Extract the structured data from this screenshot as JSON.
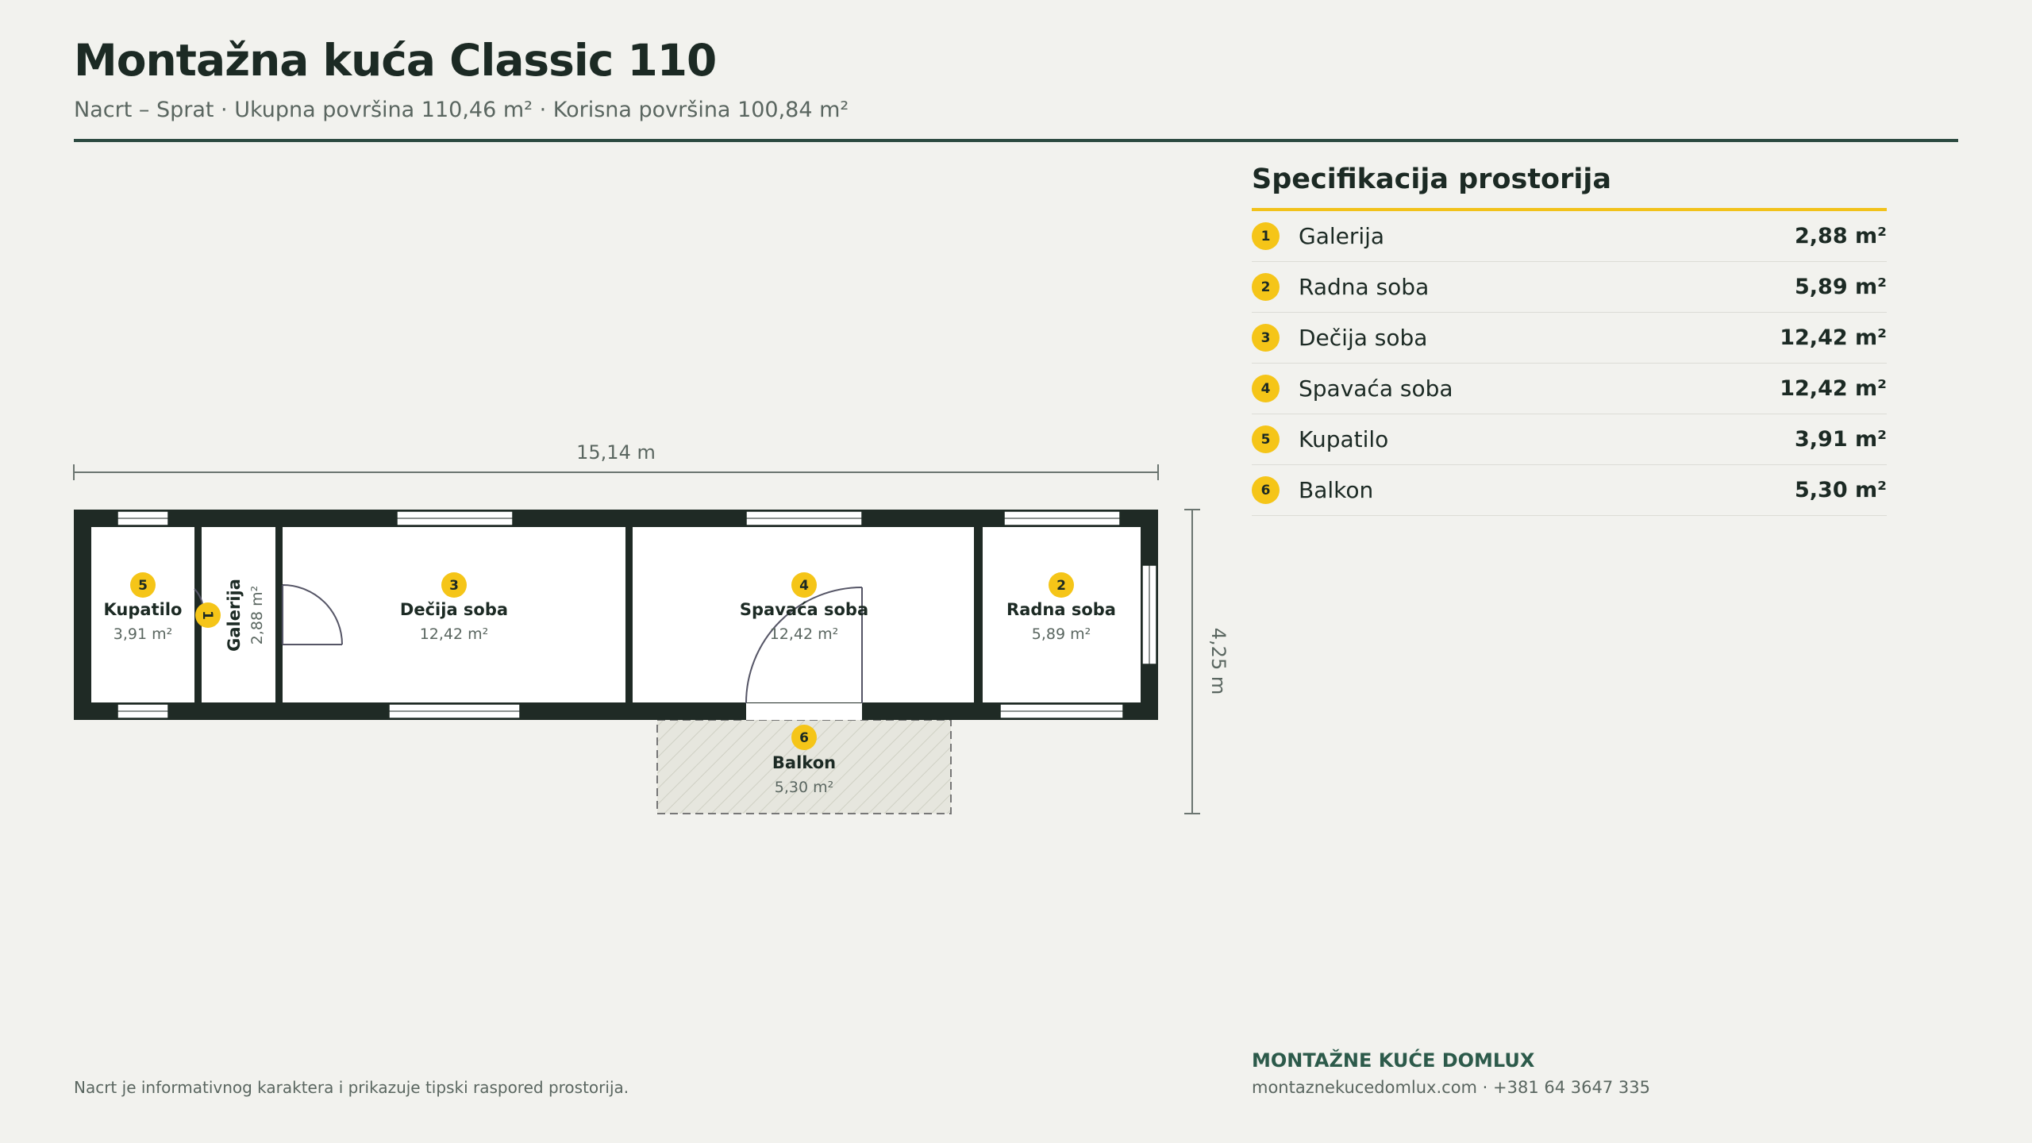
{
  "header": {
    "title": "Montažna kuća Classic 110",
    "subtitle": "Nacrt – Sprat · Ukupna površina 110,46 m² · Korisna površina 100,84 m²"
  },
  "plan": {
    "width_label": "15,14 m",
    "depth_label": "4,25 m",
    "rooms": [
      {
        "num": "5",
        "name": "Kupatilo",
        "area": "3,91 m²"
      },
      {
        "num": "1",
        "name": "Galerija",
        "area": "2,88 m²"
      },
      {
        "num": "3",
        "name": "Dečija soba",
        "area": "12,42 m²"
      },
      {
        "num": "4",
        "name": "Spavaća soba",
        "area": "12,42 m²"
      },
      {
        "num": "2",
        "name": "Radna soba",
        "area": "5,89 m²"
      },
      {
        "num": "6",
        "name": "Balkon",
        "area": "5,30 m²"
      }
    ]
  },
  "spec": {
    "title": "Specifikacija prostorija",
    "rows": [
      {
        "num": "1",
        "name": "Galerija",
        "area": "2,88 m²"
      },
      {
        "num": "2",
        "name": "Radna soba",
        "area": "5,89 m²"
      },
      {
        "num": "3",
        "name": "Dečija soba",
        "area": "12,42 m²"
      },
      {
        "num": "4",
        "name": "Spavaća soba",
        "area": "12,42 m²"
      },
      {
        "num": "5",
        "name": "Kupatilo",
        "area": "3,91 m²"
      },
      {
        "num": "6",
        "name": "Balkon",
        "area": "5,30 m²"
      }
    ]
  },
  "footer": {
    "note": "Nacrt je informativnog karaktera i prikazuje tipski raspored prostorija.",
    "brand": "MONTAŽNE KUĆE DOMLUX",
    "contact": "montaznekucedomlux.com · +381 64 3647 335"
  },
  "colors": {
    "wall": "#1f2a25",
    "badge": "#f5c518",
    "accent_rule": "#f2c21a",
    "header_rule": "#2c4a40"
  }
}
